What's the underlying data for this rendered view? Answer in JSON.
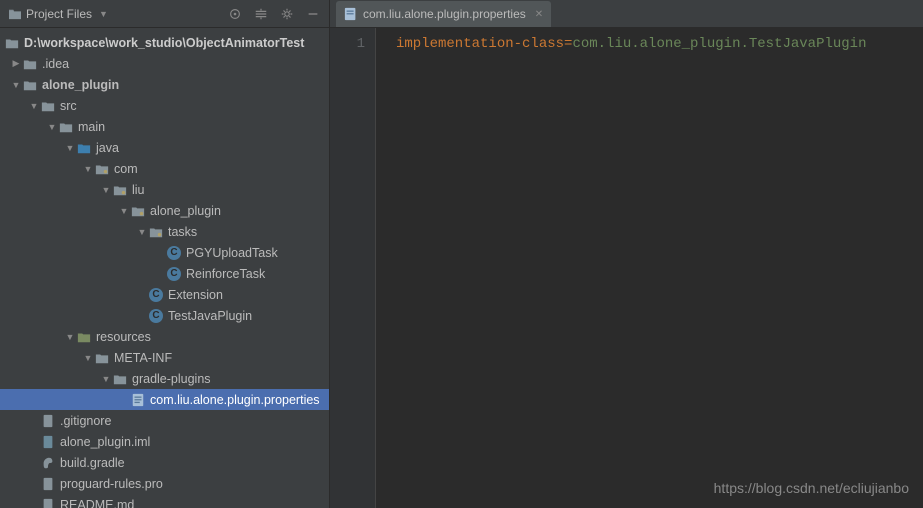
{
  "sidebar": {
    "title": "Project Files",
    "root_path": "D:\\workspace\\work_studio\\ObjectAnimatorTest",
    "tree": {
      "idea": ".idea",
      "alone_plugin": "alone_plugin",
      "src": "src",
      "main": "main",
      "java": "java",
      "com": "com",
      "liu": "liu",
      "alone_plugin_pkg": "alone_plugin",
      "tasks": "tasks",
      "pgy_upload_task": "PGYUploadTask",
      "reinforce_task": "ReinforceTask",
      "extension": "Extension",
      "test_java_plugin": "TestJavaPlugin",
      "resources": "resources",
      "meta_inf": "META-INF",
      "gradle_plugins": "gradle-plugins",
      "properties_file": "com.liu.alone.plugin.properties",
      "gitignore": ".gitignore",
      "iml": "alone_plugin.iml",
      "build_gradle": "build.gradle",
      "proguard": "proguard-rules.pro",
      "readme": "README.md"
    }
  },
  "tab": {
    "label": "com.liu.alone.plugin.properties"
  },
  "editor": {
    "line_number": "1",
    "code_key": "implementation-class",
    "code_sep": "=",
    "code_val": "com.liu.alone_plugin.TestJavaPlugin"
  },
  "watermark": "https://blog.csdn.net/ecliujianbo"
}
